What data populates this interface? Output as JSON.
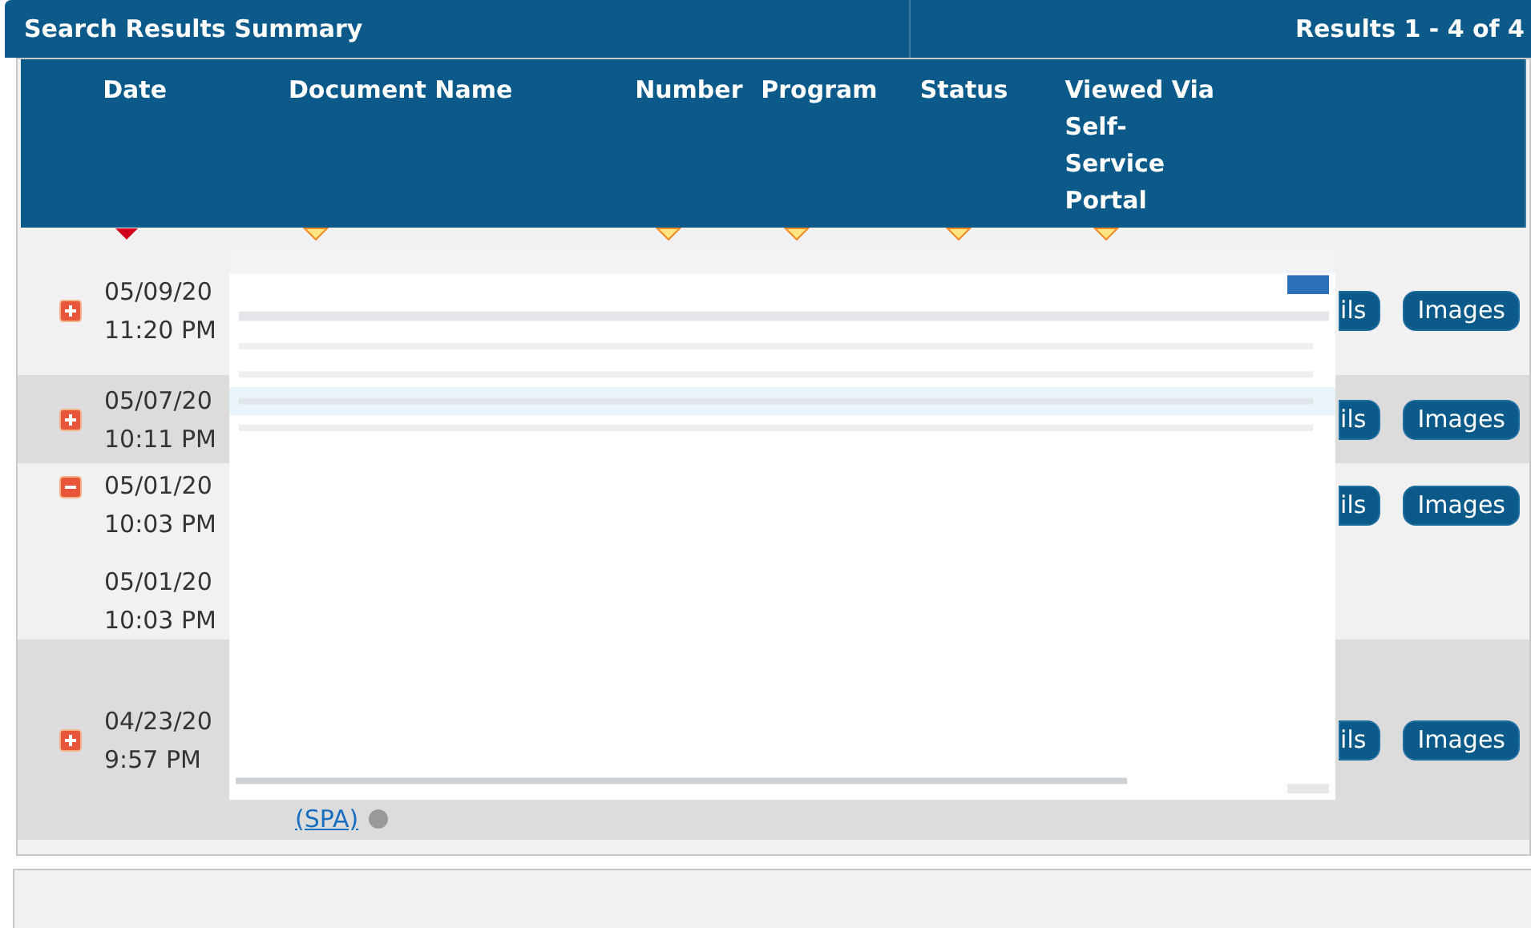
{
  "header": {
    "title": "Search Results Summary",
    "results": "Results 1 - 4 of 4"
  },
  "columns": [
    {
      "label": "Date",
      "sorted": true
    },
    {
      "label": "Document Name",
      "sorted": false
    },
    {
      "label": "Number",
      "sorted": false
    },
    {
      "label": "Program",
      "sorted": false
    },
    {
      "label": "Status",
      "sorted": false
    },
    {
      "label": "Viewed Via Self-Service Portal",
      "sorted": false
    }
  ],
  "rows": [
    {
      "expanded": false,
      "entries": [
        {
          "date": "05/09/20",
          "time": "11:20 PM"
        }
      ],
      "buttons": [
        "ils",
        "Images"
      ]
    },
    {
      "expanded": false,
      "entries": [
        {
          "date": "05/07/20",
          "time": "10:11 PM"
        }
      ],
      "buttons": [
        "ils",
        "Images"
      ]
    },
    {
      "expanded": true,
      "entries": [
        {
          "date": "05/01/20",
          "time": "10:03 PM"
        },
        {
          "date": "05/01/20",
          "time": "10:03 PM"
        }
      ],
      "buttons": [
        "ils",
        "Images"
      ]
    },
    {
      "expanded": false,
      "entries": [
        {
          "date": "04/23/20",
          "time": "9:57 PM"
        }
      ],
      "buttons": [
        "ils",
        "Images"
      ],
      "link": "(SPA)"
    }
  ]
}
